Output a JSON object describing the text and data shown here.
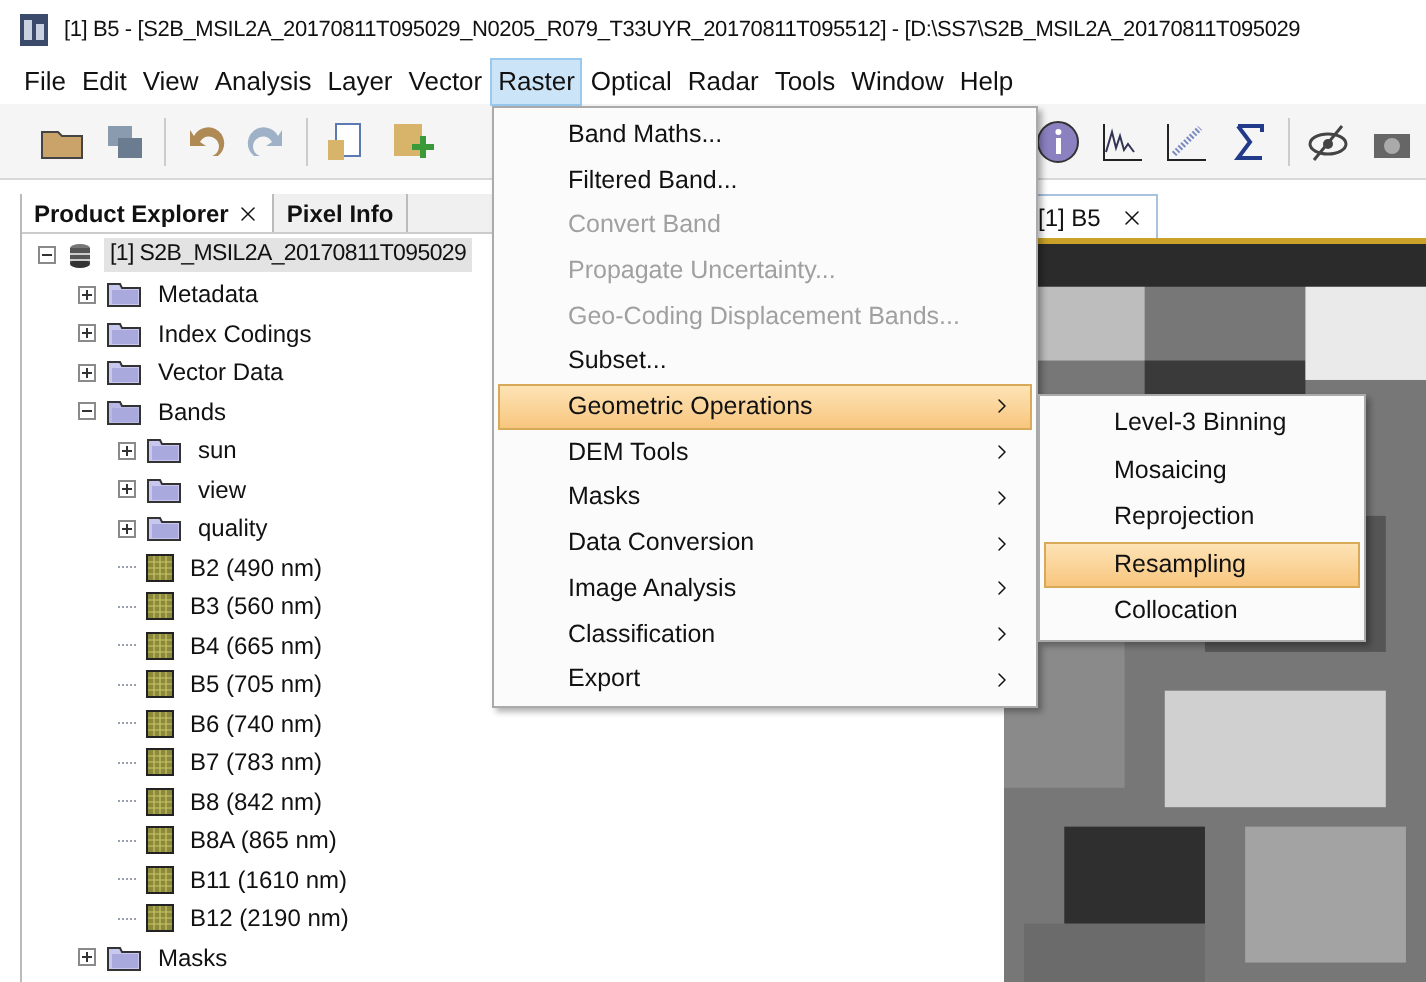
{
  "window": {
    "title": "[1] B5 - [S2B_MSIL2A_20170811T095029_N0205_R079_T33UYR_20170811T095512] - [D:\\SS7\\S2B_MSIL2A_20170811T095029"
  },
  "menu_bar": [
    {
      "label": "File",
      "selected": false
    },
    {
      "label": "Edit",
      "selected": false
    },
    {
      "label": "View",
      "selected": false
    },
    {
      "label": "Analysis",
      "selected": false
    },
    {
      "label": "Layer",
      "selected": false
    },
    {
      "label": "Vector",
      "selected": false
    },
    {
      "label": "Raster",
      "selected": true
    },
    {
      "label": "Optical",
      "selected": false
    },
    {
      "label": "Radar",
      "selected": false
    },
    {
      "label": "Tools",
      "selected": false
    },
    {
      "label": "Window",
      "selected": false
    },
    {
      "label": "Help",
      "selected": false
    }
  ],
  "side_tabs": [
    {
      "label": "Product Explorer",
      "selected": true,
      "closable": true
    },
    {
      "label": "Pixel Info",
      "selected": false,
      "closable": false
    }
  ],
  "tree": {
    "label": "[1] S2B_MSIL2A_20170811T095029",
    "kind": "product",
    "selected": true,
    "expanded": true,
    "children": [
      {
        "label": "Metadata",
        "kind": "folder",
        "expanded": false
      },
      {
        "label": "Index Codings",
        "kind": "folder",
        "expanded": false
      },
      {
        "label": "Vector Data",
        "kind": "folder",
        "expanded": false
      },
      {
        "label": "Bands",
        "kind": "folder",
        "expanded": true,
        "children": [
          {
            "label": "sun",
            "kind": "folder",
            "expanded": false
          },
          {
            "label": "view",
            "kind": "folder",
            "expanded": false
          },
          {
            "label": "quality",
            "kind": "folder",
            "expanded": false
          },
          {
            "label": "B2 (490 nm)",
            "kind": "band"
          },
          {
            "label": "B3 (560 nm)",
            "kind": "band"
          },
          {
            "label": "B4 (665 nm)",
            "kind": "band"
          },
          {
            "label": "B5 (705 nm)",
            "kind": "band"
          },
          {
            "label": "B6 (740 nm)",
            "kind": "band"
          },
          {
            "label": "B7 (783 nm)",
            "kind": "band"
          },
          {
            "label": "B8 (842 nm)",
            "kind": "band"
          },
          {
            "label": "B8A (865 nm)",
            "kind": "band"
          },
          {
            "label": "B11 (1610 nm)",
            "kind": "band"
          },
          {
            "label": "B12 (2190 nm)",
            "kind": "band"
          }
        ]
      },
      {
        "label": "Masks",
        "kind": "folder",
        "expanded": false
      }
    ]
  },
  "editor_tab": {
    "label": "[1] B5",
    "closable": true
  },
  "raster_menu": [
    {
      "label": "Band Maths...",
      "disabled": false,
      "submenu": false,
      "selected": false
    },
    {
      "label": "Filtered Band...",
      "disabled": false,
      "submenu": false,
      "selected": false
    },
    {
      "label": "Convert Band",
      "disabled": true,
      "submenu": false,
      "selected": false
    },
    {
      "label": "Propagate Uncertainty...",
      "disabled": true,
      "submenu": false,
      "selected": false
    },
    {
      "label": "Geo-Coding Displacement Bands...",
      "disabled": true,
      "submenu": false,
      "selected": false
    },
    {
      "label": "Subset...",
      "disabled": false,
      "submenu": false,
      "selected": false
    },
    {
      "label": "Geometric Operations",
      "disabled": false,
      "submenu": true,
      "selected": true
    },
    {
      "label": "DEM Tools",
      "disabled": false,
      "submenu": true,
      "selected": false
    },
    {
      "label": "Masks",
      "disabled": false,
      "submenu": true,
      "selected": false
    },
    {
      "label": "Data Conversion",
      "disabled": false,
      "submenu": true,
      "selected": false
    },
    {
      "label": "Image Analysis",
      "disabled": false,
      "submenu": true,
      "selected": false
    },
    {
      "label": "Classification",
      "disabled": false,
      "submenu": true,
      "selected": false
    },
    {
      "label": "Export",
      "disabled": false,
      "submenu": true,
      "selected": false
    }
  ],
  "geometric_submenu": [
    {
      "label": "Level-3 Binning",
      "selected": false
    },
    {
      "label": "Mosaicing",
      "selected": false
    },
    {
      "label": "Reprojection",
      "selected": false
    },
    {
      "label": "Resampling",
      "selected": true
    },
    {
      "label": "Collocation",
      "selected": false
    }
  ]
}
